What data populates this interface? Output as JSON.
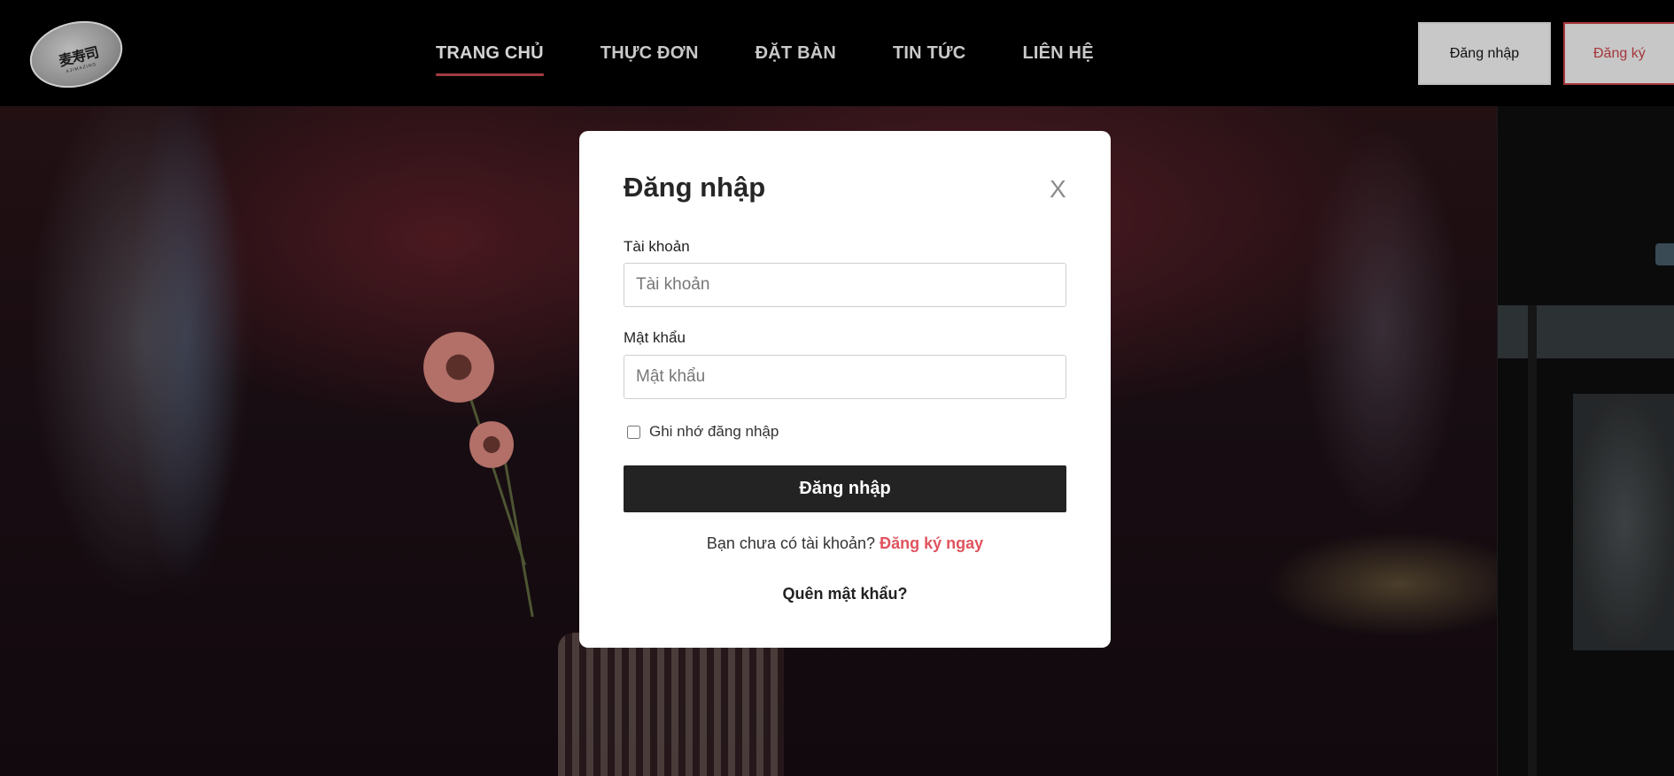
{
  "header": {
    "logo": {
      "text": "麦寿司",
      "subtext": "AJIMAZING"
    },
    "nav": [
      {
        "label": "TRANG CHỦ",
        "active": true
      },
      {
        "label": "THỰC ĐƠN",
        "active": false
      },
      {
        "label": "ĐẶT BÀN",
        "active": false
      },
      {
        "label": "TIN TỨC",
        "active": false
      },
      {
        "label": "LIÊN HỆ",
        "active": false
      }
    ],
    "login_label": "Đăng nhập",
    "register_label": "Đăng ký"
  },
  "modal": {
    "title": "Đăng nhập",
    "close_label": "X",
    "username": {
      "label": "Tài khoản",
      "placeholder": "Tài khoản",
      "value": ""
    },
    "password": {
      "label": "Mật khẩu",
      "placeholder": "Mật khẩu",
      "value": ""
    },
    "remember_label": "Ghi nhớ đăng nhập",
    "remember_checked": false,
    "submit_label": "Đăng nhập",
    "signup_prompt": "Bạn chưa có tài khoản?",
    "signup_link": "Đăng ký ngay",
    "forgot_label": "Quên mật khẩu?"
  },
  "colors": {
    "accent": "#e0535e",
    "nav_active_underline": "#a13b40",
    "submit_bg": "#232323"
  }
}
